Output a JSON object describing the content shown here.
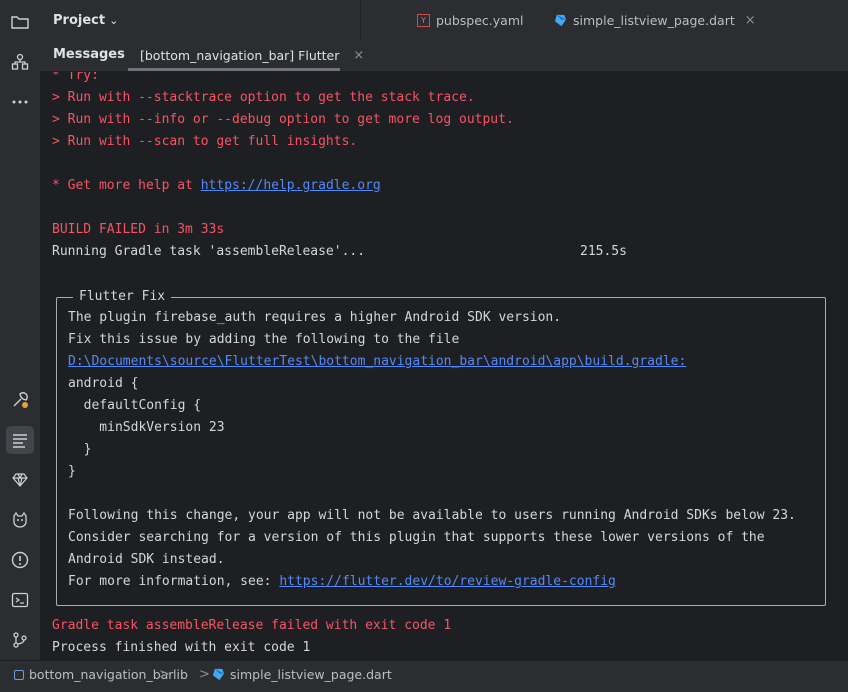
{
  "sidebar": {
    "icons": [
      "folder-icon",
      "structure-icon",
      "more-icon",
      "build-icon",
      "messages-icon",
      "gem-icon",
      "cat-icon",
      "problems-icon",
      "terminal-icon",
      "git-icon"
    ]
  },
  "header": {
    "project_label": "Project",
    "project_chevron": "⌄"
  },
  "editor_tabs": [
    {
      "label": "pubspec.yaml",
      "icon_text": "Y"
    },
    {
      "label": "simple_listview_page.dart",
      "close": "×"
    }
  ],
  "tool_window": {
    "title": "Messages",
    "tab_label": "[bottom_navigation_bar] Flutter",
    "tab_close": "×"
  },
  "console": {
    "try": "* Try:",
    "try_lines": [
      "> Run with --stacktrace option to get the stack trace.",
      "> Run with --info or --debug option to get more log output.",
      "> Run with --scan to get full insights."
    ],
    "help_prefix": "* Get more help at ",
    "help_url": "https://help.gradle.org",
    "build_failed": "BUILD FAILED in 3m 33s",
    "running_task": "Running Gradle task 'assembleRelease'...",
    "running_time": "215.5s",
    "fix_title": "Flutter Fix",
    "fix_lines": [
      "The plugin firebase_auth requires a higher Android SDK version.",
      "Fix this issue by adding the following to the file"
    ],
    "fix_path": "D:\\Documents\\source\\FlutterTest\\bottom_navigation_bar\\android\\app\\build.gradle:",
    "code_lines": [
      "android {",
      "  defaultConfig {",
      "    minSdkVersion 23",
      "  }",
      "}"
    ],
    "following_lines": [
      "Following this change, your app will not be available to users running Android SDKs below 23.",
      "Consider searching for a version of this plugin that supports these lower versions of the",
      "Android SDK instead."
    ],
    "more_info_prefix": "For more information, see: ",
    "more_info_url": "https://flutter.dev/to/review-gradle-config",
    "task_failed": "Gradle task assembleRelease failed with exit code 1",
    "process_finished": "Process finished with exit code 1"
  },
  "breadcrumbs": {
    "project": "bottom_navigation_bar",
    "folder": "lib",
    "file": "simple_listview_page.dart",
    "separator": ">"
  },
  "colors": {
    "error": "#f75464",
    "link": "#548af7",
    "background": "#1e1f22",
    "panel": "#2b2d30"
  }
}
